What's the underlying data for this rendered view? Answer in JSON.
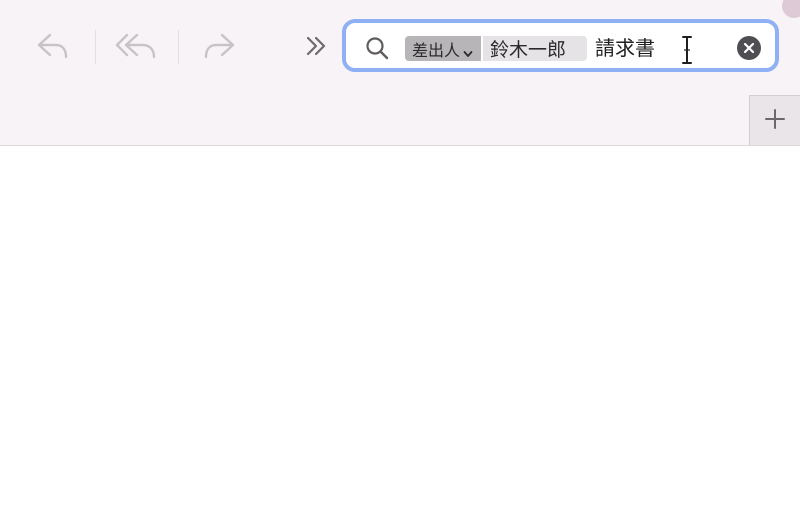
{
  "toolbar": {
    "buttons": [
      {
        "name": "reply",
        "icon": "reply-icon",
        "enabled": false
      },
      {
        "name": "reply-all",
        "icon": "reply-all-icon",
        "enabled": false
      },
      {
        "name": "forward",
        "icon": "forward-icon",
        "enabled": false
      },
      {
        "name": "more",
        "icon": "double-chevron-right-icon",
        "enabled": true
      }
    ]
  },
  "search": {
    "icon": "magnifying-glass-icon",
    "token_field_label": "差出人",
    "token_field_icon": "chevron-down-icon",
    "token_value": "鈴木一郎",
    "query": "請求書",
    "clear_icon": "clear-icon",
    "focus_ring_color": "#8fb0f4"
  },
  "tab_bar": {
    "add_icon": "plus-icon"
  },
  "colors": {
    "toolbar_background": "#f7f3f6",
    "disabled_icon": "#c8c3c7",
    "active_icon": "#6e6a6d"
  }
}
